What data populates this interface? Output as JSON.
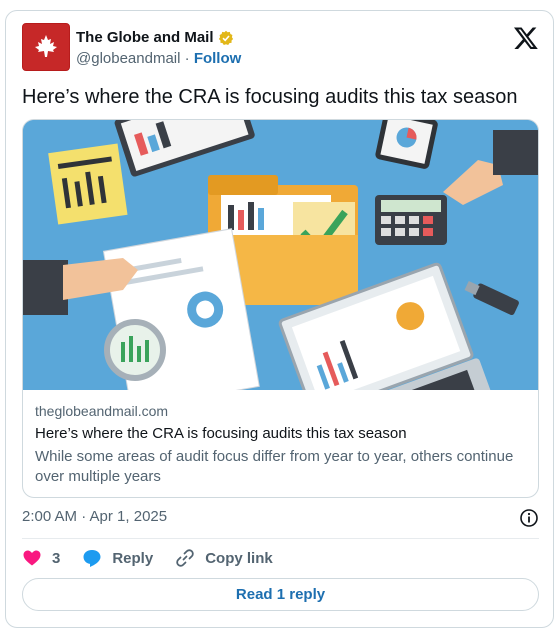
{
  "author": {
    "name": "The Globe and Mail",
    "handle": "@globeandmail",
    "separator": "·",
    "follow_label": "Follow"
  },
  "tweet": {
    "text": "Here’s where the CRA is focusing audits this tax season"
  },
  "link_card": {
    "domain": "theglobeandmail.com",
    "title": "Here’s where the CRA is focusing audits this tax season",
    "description": "While some areas of audit focus differ from year to year, others continue over multiple years"
  },
  "meta": {
    "timestamp": "2:00 AM · Apr 1, 2025"
  },
  "actions": {
    "like_count": "3",
    "reply_label": "Reply",
    "copy_link_label": "Copy link"
  },
  "read_replies_label": "Read 1 reply",
  "colors": {
    "brand_red": "#c62828",
    "link_blue": "#1d6fb0",
    "heart_pink": "#f91880",
    "muted_text": "#536471",
    "illustration_bg": "#5aa7d9"
  },
  "icons": [
    "maple-leaf-icon",
    "verified-badge-icon",
    "x-logo-icon",
    "info-icon",
    "heart-icon",
    "reply-icon",
    "copy-link-icon"
  ]
}
